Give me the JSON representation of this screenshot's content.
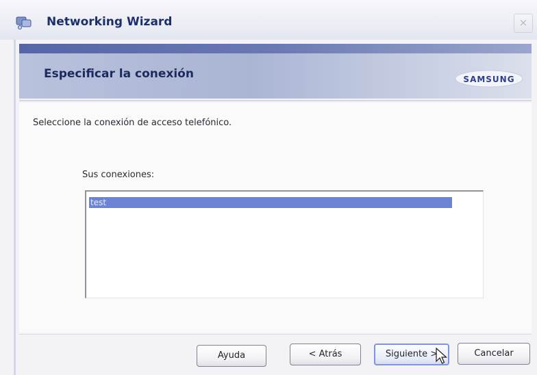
{
  "window": {
    "title": "Networking Wizard",
    "close_glyph": "×",
    "icon": "networking-wizard-icon"
  },
  "banner": {
    "title": "Especificar la conexión",
    "logo": "SAMSUNG"
  },
  "content": {
    "instructions": "Seleccione la conexión de acceso telefónico.",
    "list_label": "Sus conexiones:",
    "connections": [
      "test"
    ],
    "selected_index": 0
  },
  "buttons": {
    "help": "Ayuda",
    "back": "< Atrás",
    "next": "Siguiente >",
    "cancel": "Cancelar"
  },
  "colors": {
    "title_text": "#1c2f6c",
    "selection": "#6d83d3",
    "banner": "#aab5d4"
  }
}
